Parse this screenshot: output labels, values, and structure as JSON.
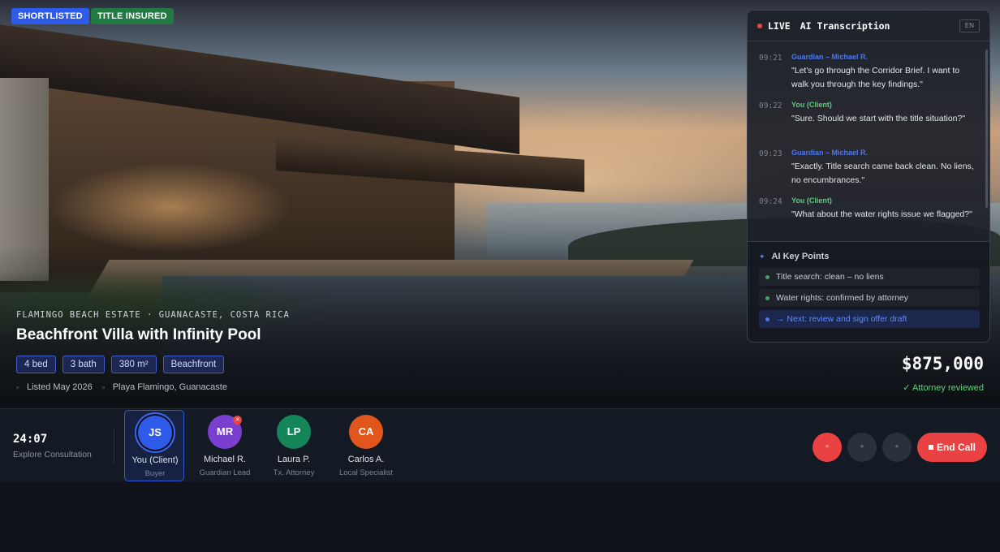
{
  "badges": {
    "shortlisted": "SHORTLISTED",
    "title_insured": "TITLE INSURED"
  },
  "property": {
    "location": "FLAMINGO BEACH ESTATE · GUANACASTE, COSTA RICA",
    "title": "Beachfront Villa with Infinity Pool",
    "chips": [
      "4 bed",
      "3 bath",
      "380 m²",
      "Beachfront"
    ],
    "listed": "Listed May 2026",
    "address": "Playa Flamingo, Guanacaste",
    "price": "$875,000",
    "review_status": "✓ Attorney reviewed"
  },
  "transcript": {
    "live_label": "LIVE",
    "title": "AI Transcription",
    "language": "EN",
    "messages": [
      {
        "time": "09:21",
        "speaker": "Guardian – Michael R.",
        "text": "\"Let's go through the Corridor Brief. I want to walk you through the key findings.\""
      },
      {
        "time": "09:22",
        "speaker": "You (Client)",
        "text": "\"Sure. Should we start with the title situation?\""
      },
      {
        "time": "09:23",
        "speaker": "Guardian – Michael R.",
        "text": "\"Exactly. Title search came back clean. No liens, no encumbrances.\""
      },
      {
        "time": "09:24",
        "speaker": "You (Client)",
        "text": "\"What about the water rights issue we flagged?\""
      }
    ],
    "key_points_title": "AI Key Points",
    "key_points": [
      "Title search: clean – no liens",
      "Water rights: confirmed by attorney",
      "→ Next: review and sign offer draft"
    ]
  },
  "call": {
    "timer": "24:07",
    "session_type": "Explore Consultation",
    "participants": [
      {
        "initials": "JS",
        "name": "You (Client)",
        "role": "Buyer",
        "color": "#2f5bea"
      },
      {
        "initials": "MR",
        "name": "Michael R.",
        "role": "Guardian Lead",
        "color": "#7b3fd0"
      },
      {
        "initials": "LP",
        "name": "Laura P.",
        "role": "Tx. Attorney",
        "color": "#14865a"
      },
      {
        "initials": "CA",
        "name": "Carlos A.",
        "role": "Local Specialist",
        "color": "#e0561c"
      }
    ],
    "muted_mark": "✕",
    "end_call_label": "End Call"
  },
  "icons": {
    "calendar": "calendar-icon",
    "pin": "map-pin-icon",
    "sparkle": "sparkle-icon",
    "mic": "microphone-icon",
    "camera": "camera-icon",
    "share": "screen-share-icon"
  }
}
